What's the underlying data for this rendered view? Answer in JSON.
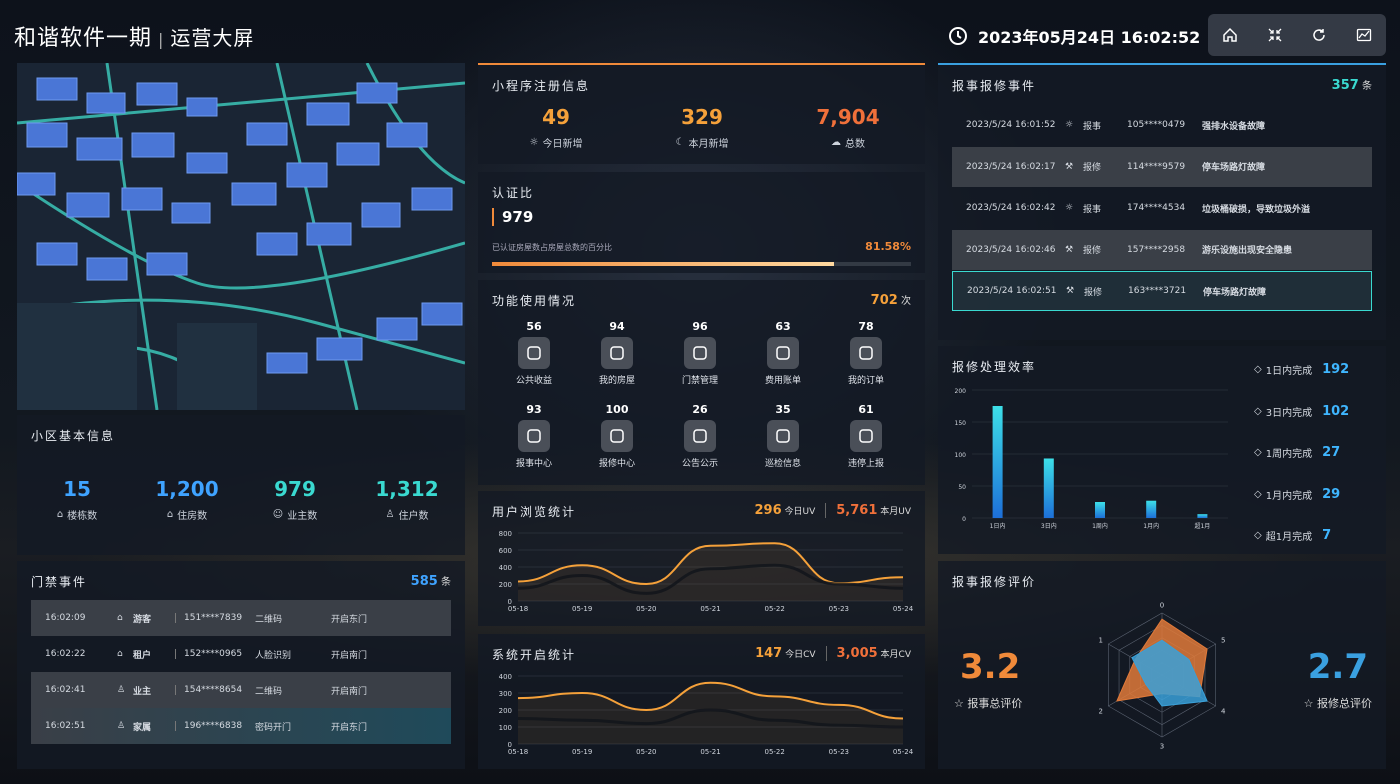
{
  "header": {
    "title": "和谐软件一期",
    "subtitle": "运营大屏",
    "datetime": "2023年05月24日 16:02:52"
  },
  "toolbar": [
    {
      "icon": "home-icon"
    },
    {
      "icon": "fullscreen-icon"
    },
    {
      "icon": "refresh-icon"
    },
    {
      "icon": "chart-icon"
    }
  ],
  "community": {
    "title": "小区基本信息",
    "stats": [
      {
        "value": "15",
        "label": "楼栋数",
        "color": "#3fa3ff"
      },
      {
        "value": "1,200",
        "label": "住房数",
        "color": "#3fa3ff"
      },
      {
        "value": "979",
        "label": "业主数",
        "color": "#3ad9d0"
      },
      {
        "value": "1,312",
        "label": "住户数",
        "color": "#3ad9d0"
      }
    ]
  },
  "access": {
    "title": "门禁事件",
    "count": "585",
    "unit": "条",
    "rows": [
      {
        "time": "16:02:09",
        "role": "游客",
        "phone": "151****7839",
        "method": "二维码",
        "gate": "开启东门"
      },
      {
        "time": "16:02:22",
        "role": "租户",
        "phone": "152****0965",
        "method": "人脸识别",
        "gate": "开启南门"
      },
      {
        "time": "16:02:41",
        "role": "业主",
        "phone": "154****8654",
        "method": "二维码",
        "gate": "开启南门"
      },
      {
        "time": "16:02:51",
        "role": "家属",
        "phone": "196****6838",
        "method": "密码开门",
        "gate": "开启东门"
      }
    ]
  },
  "miniapp": {
    "title": "小程序注册信息",
    "stats": [
      {
        "value": "49",
        "label": "今日新增",
        "color": "#f5a13a"
      },
      {
        "value": "329",
        "label": "本月新增",
        "color": "#f5a13a"
      },
      {
        "value": "7,904",
        "label": "总数",
        "color": "#f0703a"
      }
    ]
  },
  "auth": {
    "title": "认证比",
    "value": "979",
    "desc": "已认证房屋数占房屋总数的百分比",
    "percent": "81.58%",
    "ratio": 0.8158
  },
  "features": {
    "title": "功能使用情况",
    "total": "702",
    "unit": "次",
    "items": [
      {
        "count": "56",
        "label": "公共收益",
        "icon": "piggy-bank-icon"
      },
      {
        "count": "94",
        "label": "我的房屋",
        "icon": "house-icon"
      },
      {
        "count": "96",
        "label": "门禁管理",
        "icon": "door-icon"
      },
      {
        "count": "63",
        "label": "费用账单",
        "icon": "yen-icon"
      },
      {
        "count": "78",
        "label": "我的订单",
        "icon": "order-icon"
      },
      {
        "count": "93",
        "label": "报事中心",
        "icon": "alarm-icon"
      },
      {
        "count": "100",
        "label": "报修中心",
        "icon": "tools-icon"
      },
      {
        "count": "26",
        "label": "公告公示",
        "icon": "bell-icon"
      },
      {
        "count": "35",
        "label": "巡检信息",
        "icon": "location-icon"
      },
      {
        "count": "61",
        "label": "违停上报",
        "icon": "parking-icon"
      }
    ]
  },
  "browse": {
    "title": "用户浏览统计",
    "today": "296",
    "today_label": "今日UV",
    "month": "5,761",
    "month_label": "本月UV"
  },
  "system": {
    "title": "系统开启统计",
    "today": "147",
    "today_label": "今日CV",
    "month": "3,005",
    "month_label": "本月CV"
  },
  "reports": {
    "title": "报事报修事件",
    "count": "357",
    "unit": "条",
    "rows": [
      {
        "time": "2023/5/24 16:01:52",
        "type": "报事",
        "icon": "alarm-icon",
        "phone": "105****0479",
        "desc": "强排水设备故障"
      },
      {
        "time": "2023/5/24 16:02:17",
        "type": "报修",
        "icon": "wrench-icon",
        "phone": "114****9579",
        "desc": "停车场路灯故障"
      },
      {
        "time": "2023/5/24 16:02:42",
        "type": "报事",
        "icon": "alarm-icon",
        "phone": "174****4534",
        "desc": "垃圾桶破损，导致垃圾外溢"
      },
      {
        "time": "2023/5/24 16:02:46",
        "type": "报修",
        "icon": "wrench-icon",
        "phone": "157****2958",
        "desc": "游乐设施出现安全隐患"
      },
      {
        "time": "2023/5/24 16:02:51",
        "type": "报修",
        "icon": "wrench-icon",
        "phone": "163****3721",
        "desc": "停车场路灯故障"
      }
    ]
  },
  "efficiency": {
    "title": "报修处理效率",
    "items": [
      {
        "label": "1日内完成",
        "value": "192"
      },
      {
        "label": "3日内完成",
        "value": "102"
      },
      {
        "label": "1周内完成",
        "value": "27"
      },
      {
        "label": "1月内完成",
        "value": "29"
      },
      {
        "label": "超1月完成",
        "value": "7"
      }
    ]
  },
  "rating": {
    "title": "报事报修评价",
    "left_value": "3.2",
    "left_label": "报事总评价",
    "right_value": "2.7",
    "right_label": "报修总评价"
  },
  "chart_data": [
    {
      "type": "line",
      "title": "用户浏览统计",
      "x": [
        "05-18",
        "05-19",
        "05-20",
        "05-21",
        "05-22",
        "05-23",
        "05-24"
      ],
      "ylim": [
        0,
        800
      ],
      "yticks": [
        0,
        200,
        400,
        600,
        800
      ],
      "series": [
        {
          "values": [
            230,
            420,
            200,
            650,
            680,
            210,
            280
          ]
        },
        {
          "values": [
            150,
            300,
            90,
            380,
            420,
            200,
            150
          ]
        }
      ]
    },
    {
      "type": "line",
      "title": "系统开启统计",
      "x": [
        "05-18",
        "05-19",
        "05-20",
        "05-21",
        "05-22",
        "05-23",
        "05-24"
      ],
      "ylim": [
        0,
        400
      ],
      "yticks": [
        0,
        100,
        200,
        300,
        400
      ],
      "series": [
        {
          "values": [
            270,
            300,
            200,
            360,
            280,
            230,
            150
          ]
        },
        {
          "values": [
            150,
            140,
            120,
            200,
            140,
            110,
            100
          ]
        }
      ]
    },
    {
      "type": "bar",
      "title": "报修处理效率",
      "categories": [
        "1日内",
        "3日内",
        "1周内",
        "1月内",
        "超1月"
      ],
      "values": [
        175,
        93,
        25,
        27,
        6
      ],
      "ylim": [
        0,
        200
      ],
      "yticks": [
        0,
        50,
        100,
        150,
        200
      ]
    },
    {
      "type": "radar",
      "title": "报事报修评价",
      "axes": [
        "0",
        "5",
        "4",
        "3",
        "2",
        "1"
      ],
      "series": [
        {
          "values": [
            4.5,
            4.2,
            3.5,
            1.5,
            4.2,
            2.5
          ],
          "color": "#e07a3a"
        },
        {
          "values": [
            2.8,
            2.5,
            4.2,
            2.5,
            1.5,
            2.8
          ],
          "color": "#3aa0d8"
        }
      ]
    }
  ]
}
